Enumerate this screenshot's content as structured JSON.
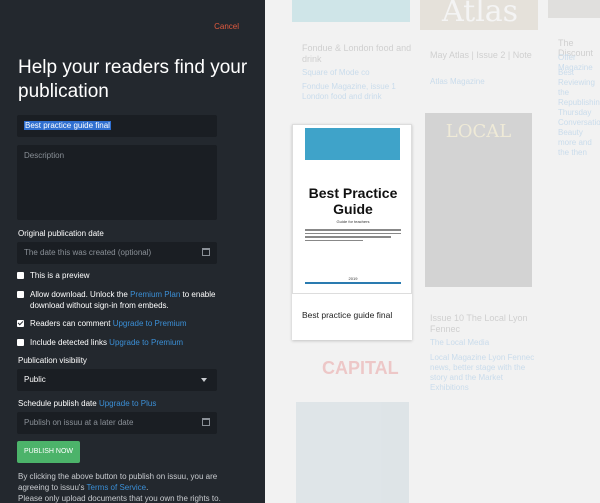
{
  "panel": {
    "cancel": "Cancel",
    "headline": "Help your readers find your publication",
    "title_value": "Best practice guide final",
    "description_placeholder": "Description",
    "pub_date_label": "Original publication date",
    "pub_date_placeholder": "The date this was created (optional)",
    "preview_label": "This is a preview",
    "download_text_1": "Allow download. Unlock the ",
    "download_link": "Premium Plan",
    "download_text_2": " to enable download without sign-in from embeds.",
    "comment_text": "Readers can comment ",
    "comment_link": "Upgrade to Premium",
    "links_text": "Include detected links ",
    "links_link": "Upgrade to Premium",
    "visibility_label": "Publication visibility",
    "visibility_value": "Public",
    "schedule_label": "Schedule publish date ",
    "schedule_link": "Upgrade to Plus",
    "schedule_placeholder": "Publish on issuu at a later date",
    "publish_button": "PUBLISH NOW",
    "footer_1": "By clicking the above button to publish on issuu, you are agreeing to issuu's ",
    "footer_link": "Terms of Service",
    "footer_2": ".",
    "footer_3": "Please only upload documents that you own the rights to."
  },
  "background": {
    "t1_title": "Fondue & London food and drink",
    "t1_pub": "Square of Mode co",
    "t1_desc": "Fondue Magazine, issue 1 London food and drink",
    "t2_title": "May Atlas | Issue 2 | Note",
    "t2_pub": "Atlas Magazine",
    "t3_title": "The Discount",
    "t3_pub": "Offer Magazine",
    "t3_desc": "Best Reviewing the Republishing Thursday Conversation Beauty more and the then",
    "local_cover_text": "LOCAL",
    "t4_title": "Issue 10 The Local Lyon Fennec",
    "t4_pub": "The Local Media",
    "t4_desc": "Local Magazine Lyon Fennec news, better stage with the story and the Market Exhibitions",
    "capital": "CAPITAL",
    "atlas_cover_text": "Atlas"
  },
  "card": {
    "cover_title": "Best Practice Guide",
    "cover_sub": "Guide for teachers",
    "cover_year": "2019",
    "caption": "Best practice guide final"
  },
  "colors": {
    "panel_bg": "#23282e",
    "field_bg": "#1a1e23",
    "accent_link": "#3b8fd6",
    "cancel": "#e25a3f",
    "publish": "#4cb36a"
  }
}
